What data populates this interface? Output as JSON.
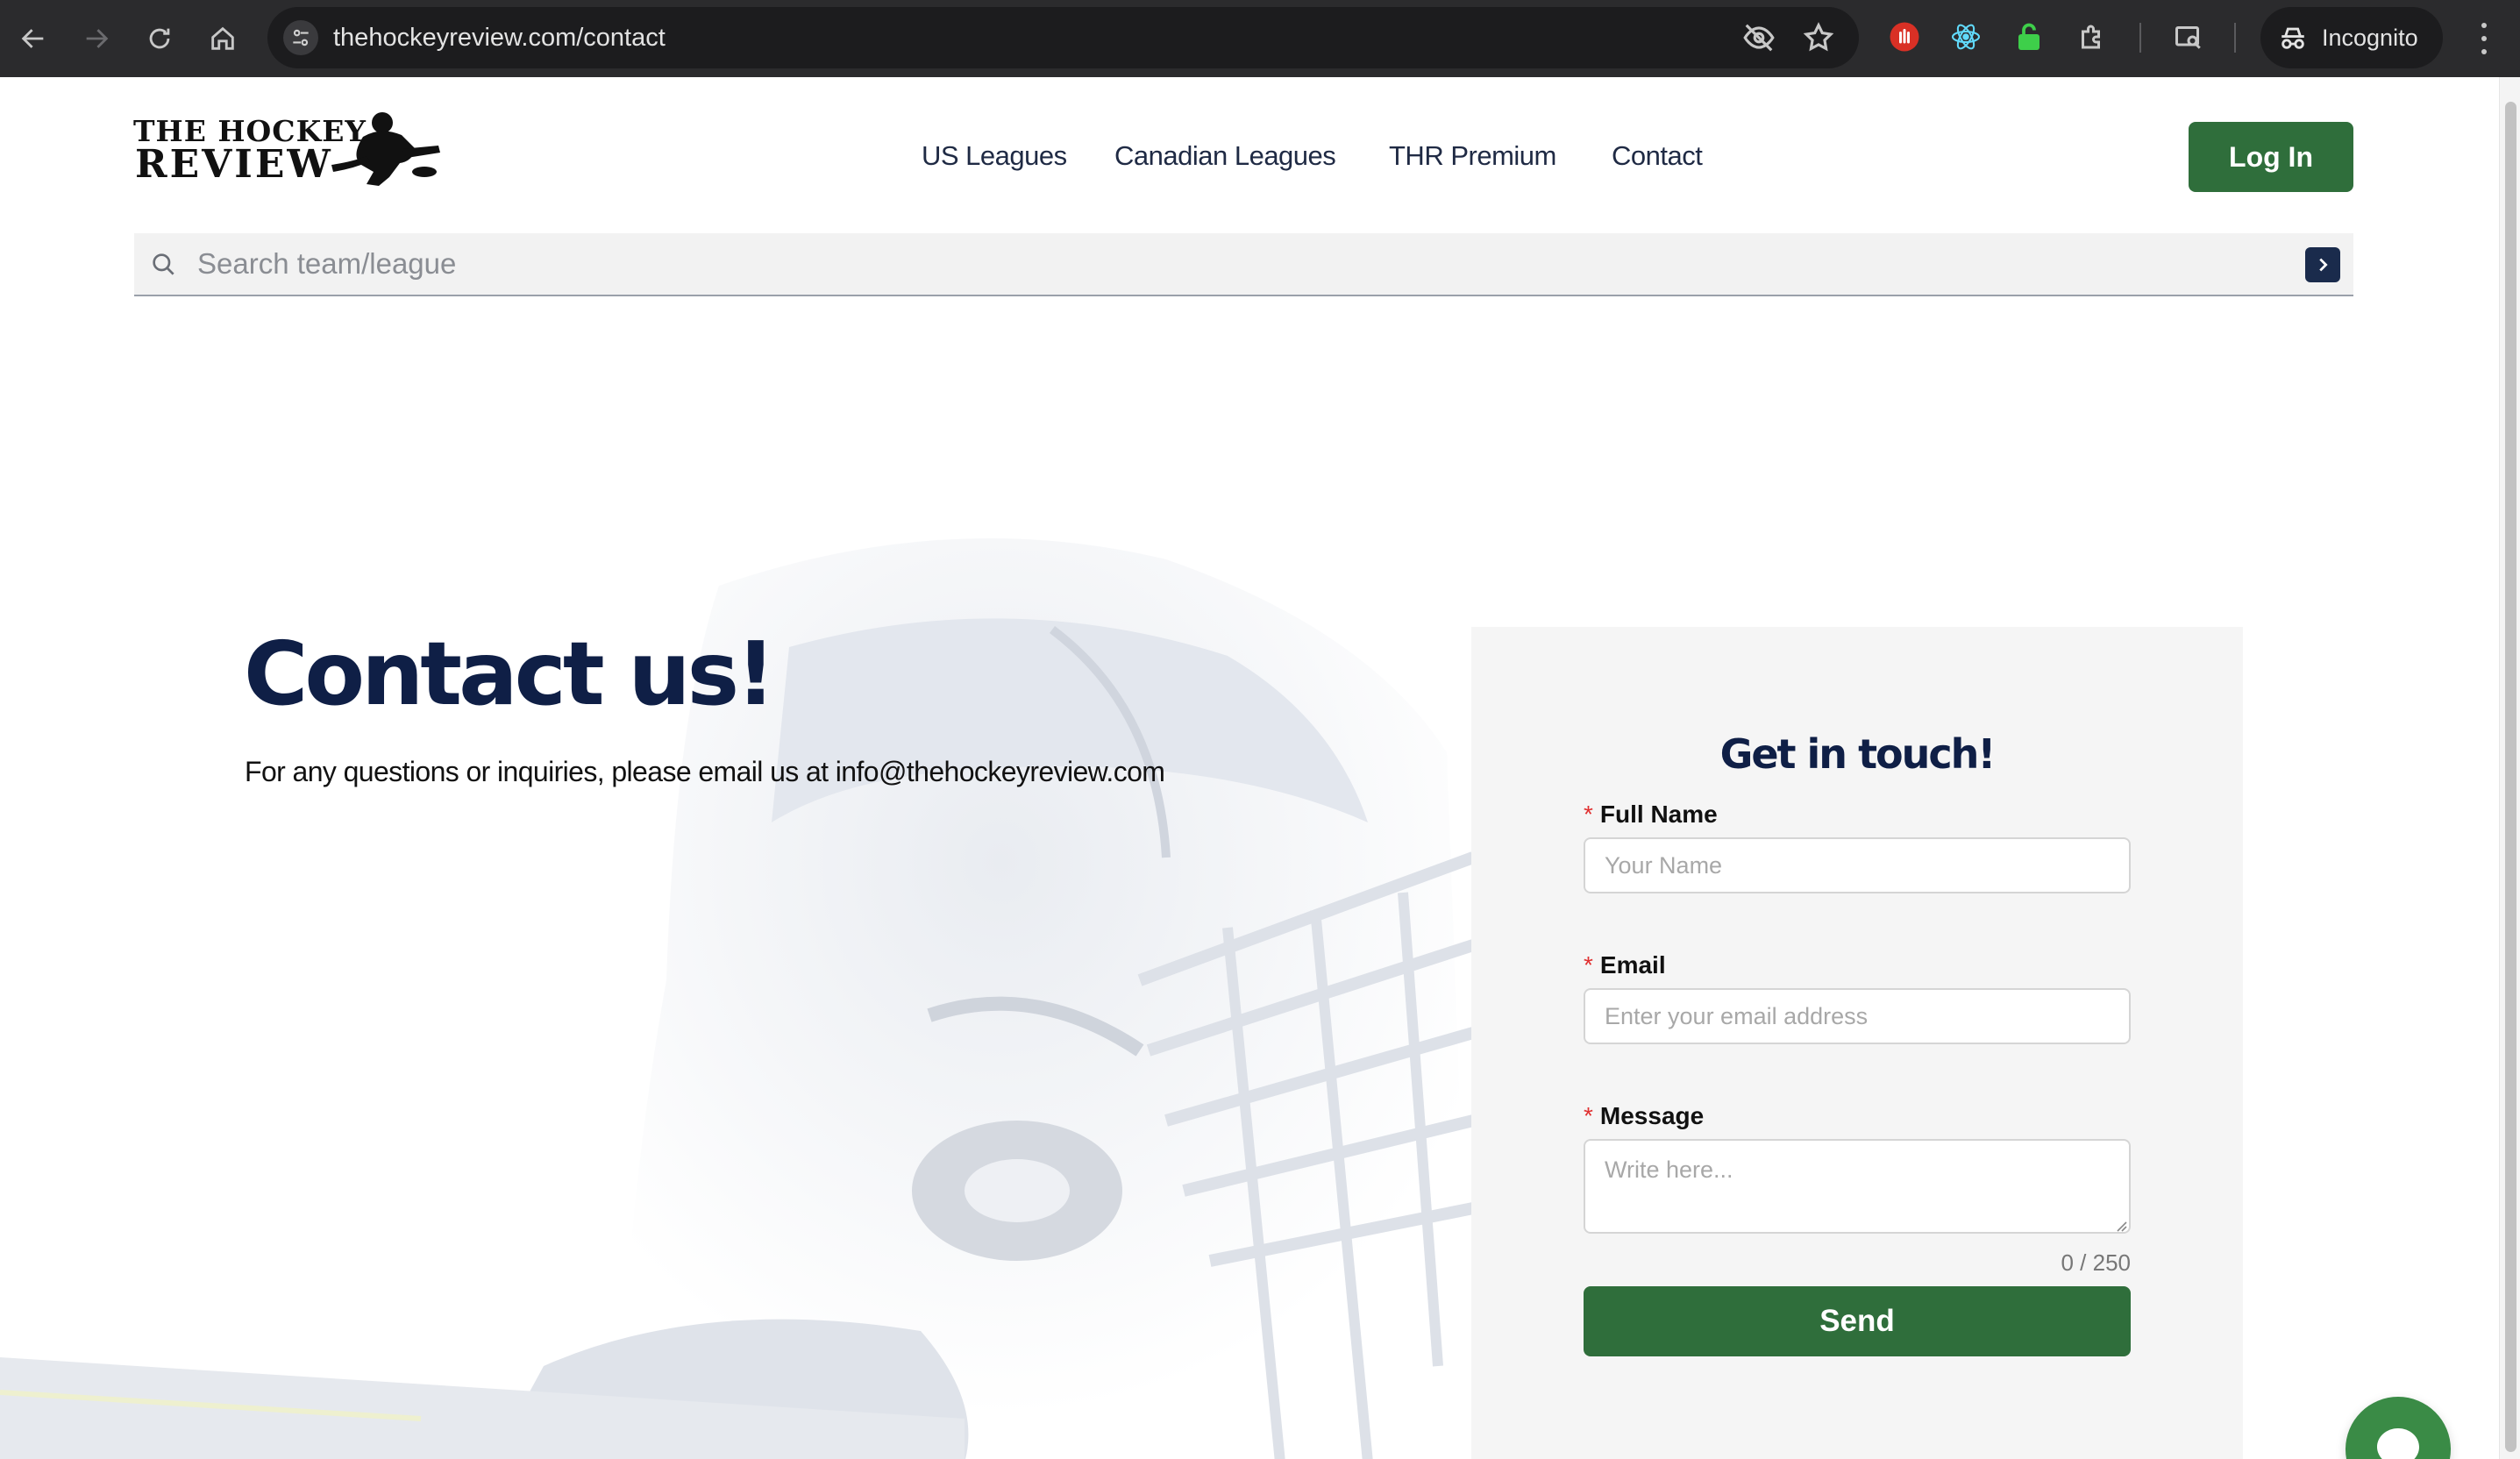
{
  "browser": {
    "url": "thehockeyreview.com/contact",
    "profile_label": "Incognito",
    "icons": [
      "back-icon",
      "forward-icon",
      "reload-icon",
      "home-icon",
      "site-settings-icon",
      "eye-off-icon",
      "star-icon",
      "extension-hand-icon",
      "extension-react-icon",
      "extension-lock-icon",
      "puzzle-icon",
      "tab-search-icon",
      "incognito-icon",
      "more-icon"
    ]
  },
  "site": {
    "logo_line1": "THE HOCKEY",
    "logo_line2": "REVIEW",
    "nav": [
      {
        "label": "US Leagues"
      },
      {
        "label": "Canadian Leagues"
      },
      {
        "label": "THR Premium"
      },
      {
        "label": "Contact"
      }
    ],
    "login_label": "Log In",
    "search_placeholder": "Search team/league",
    "accent_green": "#2f6e3b",
    "navy": "#0f1f46"
  },
  "hero": {
    "title": "Contact us!",
    "description": "For any questions or inquiries, please email us at info@thehockeyreview.com"
  },
  "form": {
    "title": "Get in touch!",
    "required_mark": "*",
    "name_label": "Full Name",
    "name_placeholder": "Your Name",
    "email_label": "Email",
    "email_placeholder": "Enter your email address",
    "message_label": "Message",
    "message_placeholder": "Write here...",
    "counter": "0 / 250",
    "send_label": "Send"
  }
}
